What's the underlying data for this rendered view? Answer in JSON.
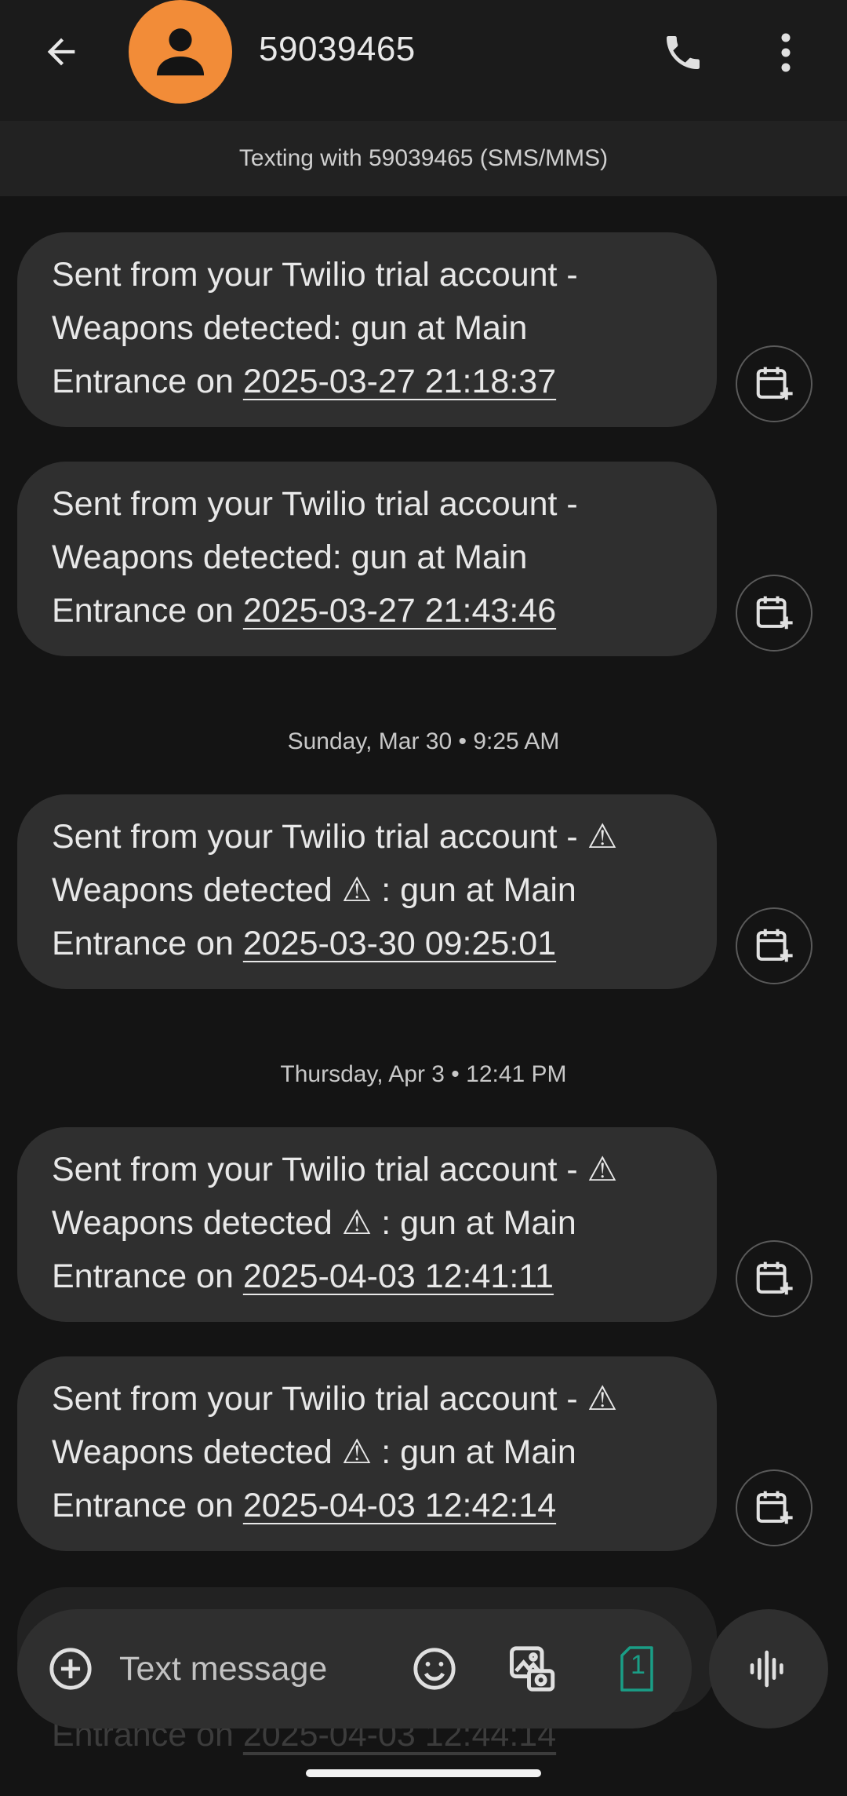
{
  "header": {
    "contact_name": "59039465",
    "subtitle": "Texting with 59039465 (SMS/MMS)",
    "avatar_color": "#f28c38",
    "icons": [
      "back-arrow-icon",
      "person-icon",
      "phone-icon",
      "more-vert-icon"
    ]
  },
  "messages": [
    {
      "line1": "Sent from your Twilio trial account -",
      "line2": "Weapons detected: gun at Main",
      "line3_prefix": "Entrance on ",
      "timestamp": "2025-03-27 21:18:37"
    },
    {
      "line1": "Sent from your Twilio trial account -",
      "line2": "Weapons detected: gun at Main",
      "line3_prefix": "Entrance on ",
      "timestamp": "2025-03-27 21:43:46"
    },
    {
      "line1": "Sent from your Twilio trial account - ⚠",
      "line2": "Weapons detected ⚠ : gun at Main",
      "line3_prefix": "Entrance on ",
      "timestamp": "2025-03-30 09:25:01"
    },
    {
      "line1": "Sent from your Twilio trial account - ⚠",
      "line2": "Weapons detected ⚠ : gun at Main",
      "line3_prefix": "Entrance on ",
      "timestamp": "2025-04-03 12:41:11"
    },
    {
      "line1": "Sent from your Twilio trial account - ⚠",
      "line2": "Weapons detected ⚠ : gun at Main",
      "line3_prefix": "Entrance on ",
      "timestamp": "2025-04-03 12:42:14"
    }
  ],
  "dividers": [
    "Sunday, Mar 30 • 9:25 AM",
    "Thursday, Apr 3 • 12:41 PM"
  ],
  "partial_message": {
    "prefix": "Entrance on ",
    "timestamp": "2025-04-03 12:44:14"
  },
  "composer": {
    "placeholder": "Text message",
    "sim_number": "1",
    "icons": [
      "add-circle-icon",
      "emoji-icon",
      "gallery-icon",
      "sim-card-icon",
      "voice-waveform-icon"
    ]
  },
  "colors": {
    "background": "#141414",
    "bubble": "#2f2f2f",
    "sim_accent": "#1a9e86"
  }
}
